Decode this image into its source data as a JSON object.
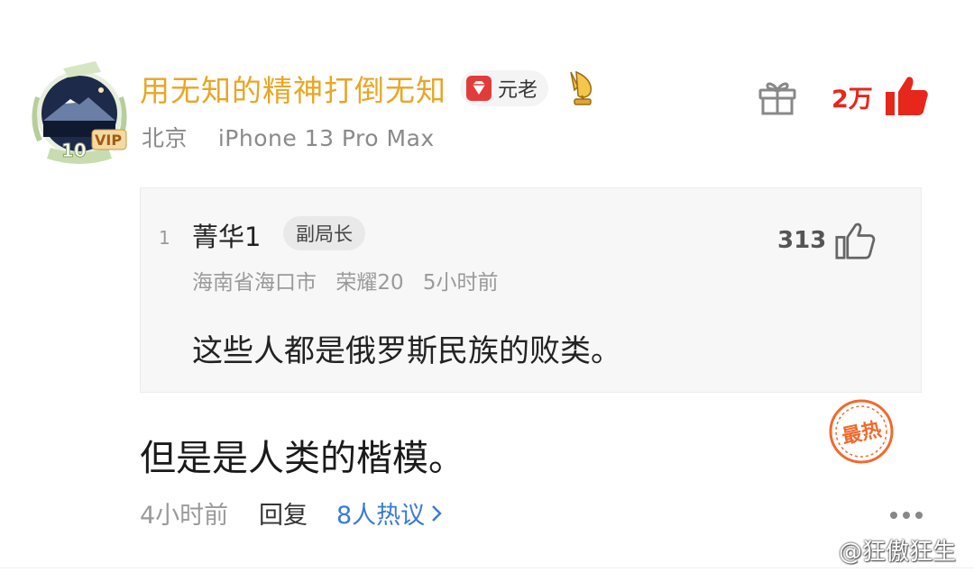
{
  "comment": {
    "username": "用无知的精神打倒无知",
    "badge_label": "元老",
    "avatar_level": "10",
    "avatar_vip": "VIP",
    "location": "北京",
    "device": "iPhone 13 Pro Max",
    "like_count": "2万",
    "text": "但是是人类的楷模。",
    "time": "4小时前",
    "reply_label": "回复",
    "discuss_label": "8人热议",
    "hot_stamp": "最热"
  },
  "quote": {
    "index": "1",
    "username": "菁华1",
    "badge_label": "副局长",
    "like_count": "313",
    "location": "海南省海口市",
    "device": "荣耀20",
    "time": "5小时前",
    "text": "这些人都是俄罗斯民族的败类。"
  },
  "watermark": "@狂傲狂生",
  "colors": {
    "username": "#e8a626",
    "like_red": "#e7261c",
    "link_blue": "#3a7bd5",
    "stamp_orange": "#f06a2e"
  }
}
